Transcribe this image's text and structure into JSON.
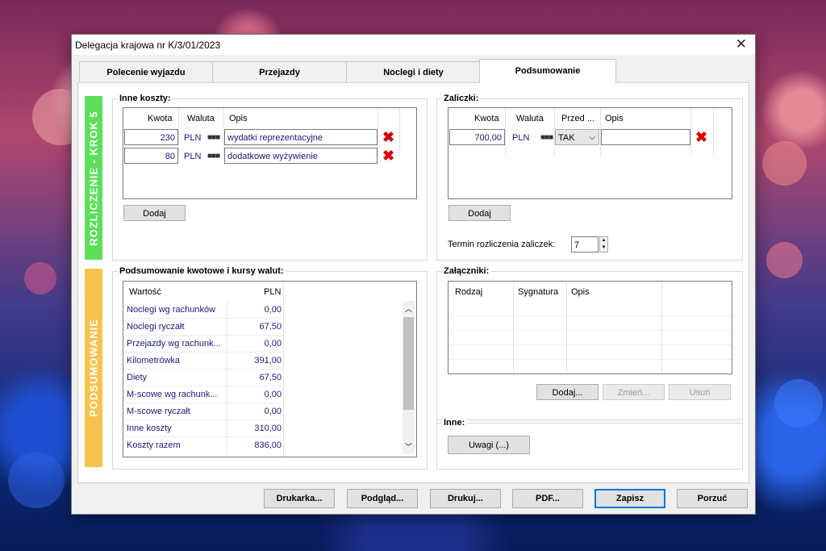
{
  "window": {
    "title": "Delegacja krajowa nr K/3/01/2023",
    "close": "✕"
  },
  "tabs": [
    {
      "label": "Polecenie wyjazdu"
    },
    {
      "label": "Przejazdy"
    },
    {
      "label": "Noclegi i diety"
    },
    {
      "label": "Podsumowanie"
    }
  ],
  "steps": {
    "step5": {
      "label": "ROZLICZENIE - KROK 5",
      "color": "#5ce05c"
    },
    "summary": {
      "label": "PODSUMOWANIE",
      "color": "#f5c34f"
    }
  },
  "inne_koszty": {
    "title": "Inne koszty:",
    "headers": {
      "kwota": "Kwota",
      "waluta": "Waluta",
      "opis": "Opis"
    },
    "rows": [
      {
        "kwota": "230",
        "waluta": "PLN",
        "opis": "wydatki reprezentacyjne"
      },
      {
        "kwota": "80",
        "waluta": "PLN",
        "opis": "dodatkowe wyżywienie"
      }
    ],
    "add_button": "Dodaj"
  },
  "zaliczki": {
    "title": "Zaliczki:",
    "headers": {
      "kwota": "Kwota",
      "waluta": "Waluta",
      "przed": "Przed ...",
      "opis": "Opis"
    },
    "rows": [
      {
        "kwota": "700,00",
        "waluta": "PLN",
        "przed": "TAK",
        "opis": ""
      }
    ],
    "add_button": "Dodaj",
    "termin_label": "Termin rozliczenia zaliczek:",
    "termin_value": "7"
  },
  "podsumowanie": {
    "title": "Podsumowanie kwotowe i kursy walut:",
    "headers": {
      "wartosc": "Wartość",
      "pln": "PLN"
    },
    "rows": [
      {
        "label": "Noclegi wg rachunków",
        "value": "0,00"
      },
      {
        "label": "Noclegi ryczałt",
        "value": "67,50"
      },
      {
        "label": "Przejazdy wg rachunk...",
        "value": "0,00"
      },
      {
        "label": "Kilometrówka",
        "value": "391,00"
      },
      {
        "label": "Diety",
        "value": "67,50"
      },
      {
        "label": "M-scowe wg rachunk...",
        "value": "0,00"
      },
      {
        "label": "M-scowe ryczałt",
        "value": "0,00"
      },
      {
        "label": "Inne koszty",
        "value": "310,00"
      },
      {
        "label": "Koszty razem",
        "value": "836,00"
      }
    ]
  },
  "zalaczniki": {
    "title": "Załączniki:",
    "headers": {
      "rodzaj": "Rodzaj",
      "sygnatura": "Sygnatura",
      "opis": "Opis"
    },
    "buttons": {
      "dodaj": "Dodaj...",
      "zmien": "Zmień...",
      "usun": "Usuń"
    }
  },
  "inne": {
    "title": "Inne:",
    "uwagi_button": "Uwagi (...)"
  },
  "footer": {
    "drukarka": "Drukarka...",
    "podglad": "Podgląd...",
    "drukuj": "Drukuj...",
    "pdf": "PDF...",
    "zapisz": "Zapisz",
    "porzuc": "Porzuć"
  },
  "icons": {
    "delete": "red-x-icon",
    "more": "ellipsis-icon",
    "dropdown": "chevron-down-icon",
    "spin": "spin-arrows-icon"
  }
}
